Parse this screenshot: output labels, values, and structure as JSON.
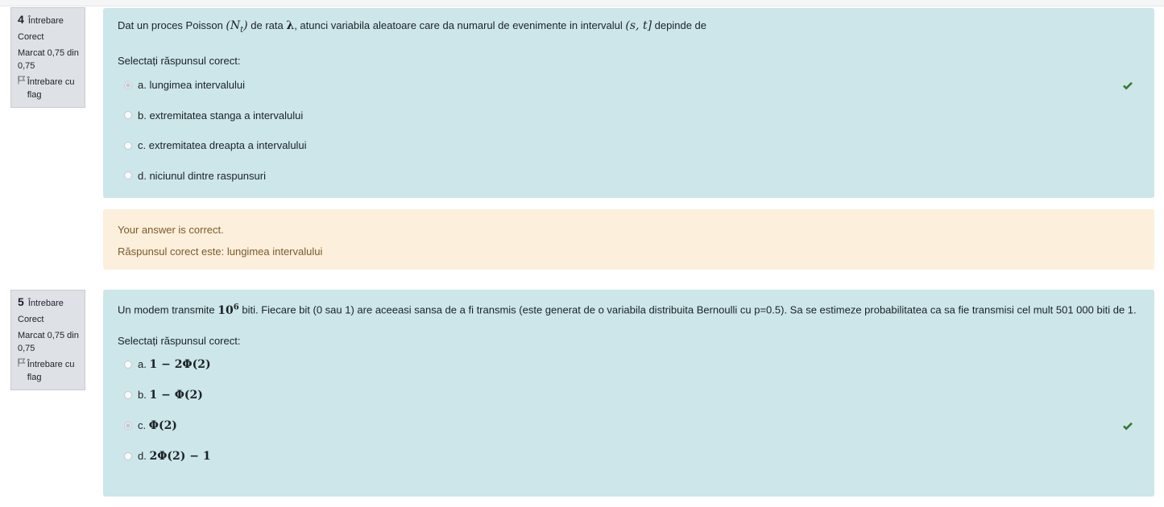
{
  "questions": [
    {
      "number": "4",
      "label": "Întrebare",
      "status": "Corect",
      "mark": "Marcat 0,75 din 0,75",
      "flag_label": "Întrebare cu flag",
      "text_parts": [
        "Dat un proces Poisson",
        "(N",
        "t",
        ")",
        "de rata",
        "λ",
        ",  atunci variabila aleatoare care da numarul de evenimente in intervalul",
        "(s, t]",
        "depinde de"
      ],
      "prompt": "Selectați răspunsul corect:",
      "answers": [
        {
          "text": "a. lungimea intervalului",
          "selected": true,
          "correct": true
        },
        {
          "text": "b. extremitatea stanga a intervalului",
          "selected": false,
          "correct": false
        },
        {
          "text": "c. extremitatea dreapta a intervalului",
          "selected": false,
          "correct": false
        },
        {
          "text": "d. niciunul dintre raspunsuri",
          "selected": false,
          "correct": false
        }
      ],
      "feedback": {
        "line1": "Your answer is correct.",
        "line2": "Răspunsul corect este: lungimea intervalului"
      }
    },
    {
      "number": "5",
      "label": "Întrebare",
      "status": "Corect",
      "mark": "Marcat 0,75 din 0,75",
      "flag_label": "Întrebare cu flag",
      "text_parts": [
        "Un modem transmite",
        "10",
        "6",
        "biti. Fiecare bit (0 sau 1) are aceeasi sansa de a fi transmis (este generat de o variabila distribuita Bernoulli cu p=0.5). Sa se estimeze probabilitatea ca sa fie transmisi cel mult 501 000 biti de 1."
      ],
      "prompt": "Selectați răspunsul corect:",
      "answers": [
        {
          "prefix": "a.",
          "math": "1 − 2Φ(2)",
          "selected": false,
          "correct": false
        },
        {
          "prefix": "b.",
          "math": "1 − Φ(2)",
          "selected": false,
          "correct": false
        },
        {
          "prefix": "c.",
          "math": "Φ(2)",
          "selected": true,
          "correct": true
        },
        {
          "prefix": "d.",
          "math": "2Φ(2) − 1",
          "selected": false,
          "correct": false
        }
      ]
    }
  ],
  "colors": {
    "content_bg": "#cce6ea",
    "feedback_bg": "#fcefdc",
    "info_bg": "#dee2e6",
    "check": "#357a32"
  },
  "icons": {
    "flag": "flag-outline-icon",
    "check": "checkmark-icon"
  }
}
